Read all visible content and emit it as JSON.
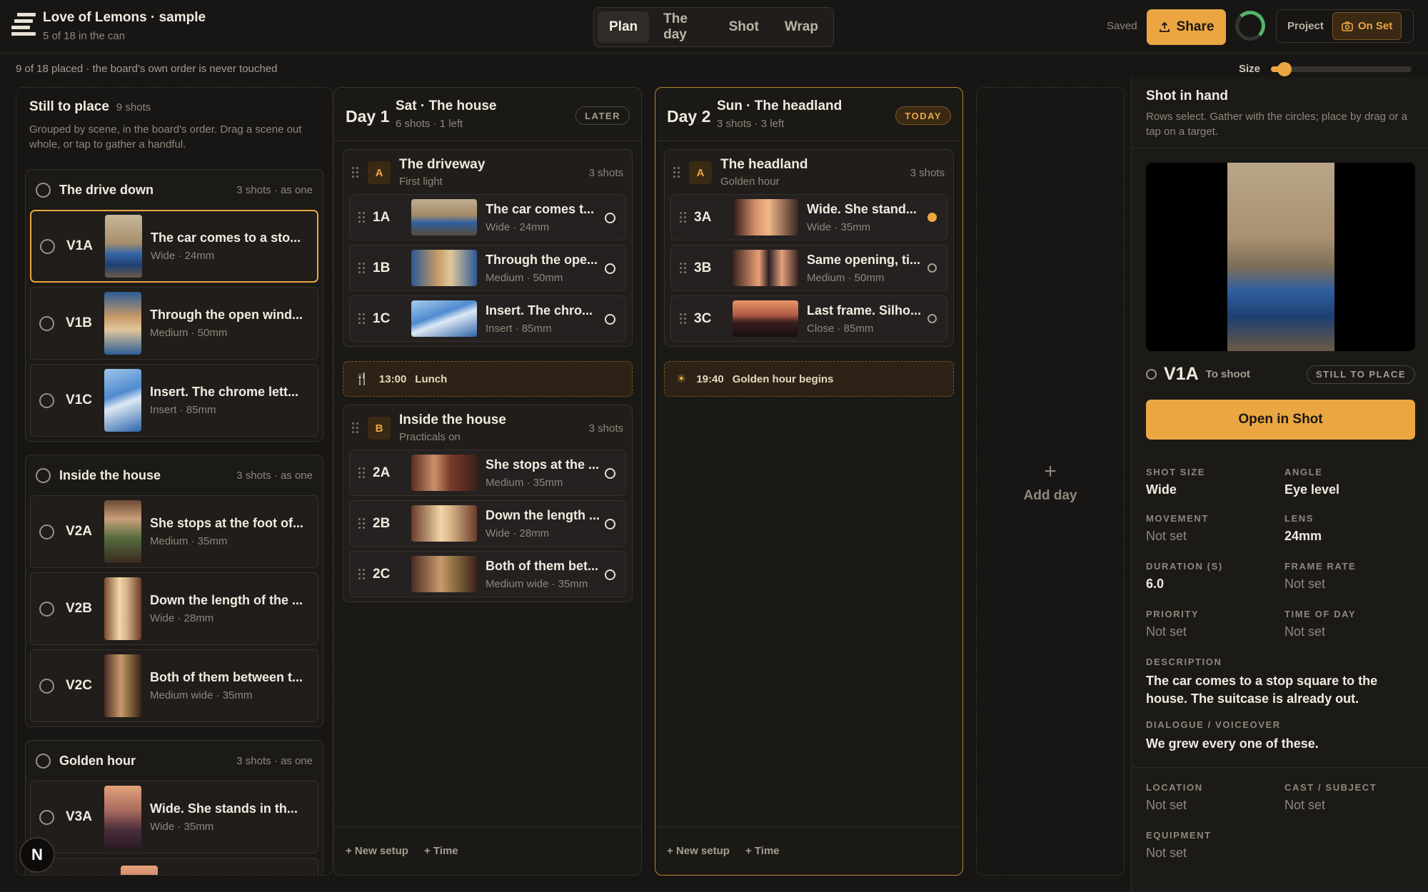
{
  "app": {
    "title": "Love of Lemons · sample",
    "subtitle": "5 of 18 in the can"
  },
  "tabs": [
    "Plan",
    "The day",
    "Shot",
    "Wrap"
  ],
  "header": {
    "saved": "Saved",
    "share": "Share",
    "project": "Project",
    "on_set": "On Set"
  },
  "subbar": {
    "status": "9 of 18 placed · the board's own order is never touched",
    "size_label": "Size",
    "size_value": 0.05
  },
  "left": {
    "title": "Still to place",
    "count": "9 shots",
    "desc": "Grouped by scene, in the board's order. Drag a scene out whole, or tap to gather a handful.",
    "groups": [
      {
        "name": "The drive down",
        "meta": "3 shots · as one",
        "shots": [
          {
            "code": "V1A",
            "title": "The car comes to a sto...",
            "meta": "Wide · 24mm"
          },
          {
            "code": "V1B",
            "title": "Through the open wind...",
            "meta": "Medium · 50mm"
          },
          {
            "code": "V1C",
            "title": "Insert. The chrome lett...",
            "meta": "Insert · 85mm"
          }
        ]
      },
      {
        "name": "Inside the house",
        "meta": "3 shots · as one",
        "shots": [
          {
            "code": "V2A",
            "title": "She stops at the foot of...",
            "meta": "Medium · 35mm"
          },
          {
            "code": "V2B",
            "title": "Down the length of the ...",
            "meta": "Wide · 28mm"
          },
          {
            "code": "V2C",
            "title": "Both of them between t...",
            "meta": "Medium wide · 35mm"
          }
        ]
      },
      {
        "name": "Golden hour",
        "meta": "3 shots · as one",
        "shots": [
          {
            "code": "V3A",
            "title": "Wide. She stands in th...",
            "meta": "Wide · 35mm"
          }
        ]
      }
    ]
  },
  "day1": {
    "day": "Day 1",
    "name": "Sat · The house",
    "sub": "6 shots · 1 left",
    "badge": "LATER",
    "setupA": {
      "letter": "A",
      "name": "The driveway",
      "sub": "First light",
      "count": "3 shots",
      "shots": [
        {
          "code": "1A",
          "title": "The car comes t...",
          "meta": "Wide · 24mm"
        },
        {
          "code": "1B",
          "title": "Through the ope...",
          "meta": "Medium · 50mm"
        },
        {
          "code": "1C",
          "title": "Insert. The chro...",
          "meta": "Insert · 85mm"
        }
      ]
    },
    "event": {
      "time": "13:00",
      "label": "Lunch"
    },
    "setupB": {
      "letter": "B",
      "name": "Inside the house",
      "sub": "Practicals on",
      "count": "3 shots",
      "shots": [
        {
          "code": "2A",
          "title": "She stops at the ...",
          "meta": "Medium · 35mm"
        },
        {
          "code": "2B",
          "title": "Down the length ...",
          "meta": "Wide · 28mm"
        },
        {
          "code": "2C",
          "title": "Both of them bet...",
          "meta": "Medium wide · 35mm"
        }
      ]
    },
    "new_setup": "+ New setup",
    "time": "+ Time"
  },
  "day2": {
    "day": "Day 2",
    "name": "Sun · The headland",
    "sub": "3 shots · 3 left",
    "badge": "TODAY",
    "setupA": {
      "letter": "A",
      "name": "The headland",
      "sub": "Golden hour",
      "count": "3 shots",
      "shots": [
        {
          "code": "3A",
          "title": "Wide. She stand...",
          "meta": "Wide · 35mm"
        },
        {
          "code": "3B",
          "title": "Same opening, ti...",
          "meta": "Medium · 50mm"
        },
        {
          "code": "3C",
          "title": "Last frame. Silho...",
          "meta": "Close · 85mm"
        }
      ]
    },
    "event": {
      "time": "19:40",
      "label": "Golden hour begins"
    },
    "new_setup": "+ New setup",
    "time": "+ Time"
  },
  "add_day": {
    "plus": "+",
    "label": "Add day"
  },
  "right": {
    "title": "Shot in hand",
    "desc": "Rows select. Gather with the circles; place by drag or a tap on a target.",
    "code": "V1A",
    "status": "To shoot",
    "badge": "STILL TO PLACE",
    "open_btn": "Open in Shot",
    "fields": {
      "shot_size": {
        "label": "SHOT SIZE",
        "value": "Wide"
      },
      "angle": {
        "label": "ANGLE",
        "value": "Eye level"
      },
      "movement": {
        "label": "MOVEMENT",
        "value": "Not set"
      },
      "lens": {
        "label": "LENS",
        "value": "24mm"
      },
      "duration": {
        "label": "DURATION (S)",
        "value": "6.0"
      },
      "frame_rate": {
        "label": "FRAME RATE",
        "value": "Not set"
      },
      "priority": {
        "label": "PRIORITY",
        "value": "Not set"
      },
      "time_of_day": {
        "label": "TIME OF DAY",
        "value": "Not set"
      },
      "description": {
        "label": "DESCRIPTION",
        "value": "The car comes to a stop square to the house. The suitcase is already out."
      },
      "dialogue": {
        "label": "DIALOGUE / VOICEOVER",
        "value": "We grew every one of these."
      },
      "location": {
        "label": "LOCATION",
        "value": "Not set"
      },
      "cast": {
        "label": "CAST / SUBJECT",
        "value": "Not set"
      },
      "equipment": {
        "label": "EQUIPMENT",
        "value": "Not set"
      }
    }
  },
  "corner_badge": "N",
  "colors": {
    "accent": "#eba642",
    "bg": "#181614",
    "ready": "#53b56a"
  }
}
